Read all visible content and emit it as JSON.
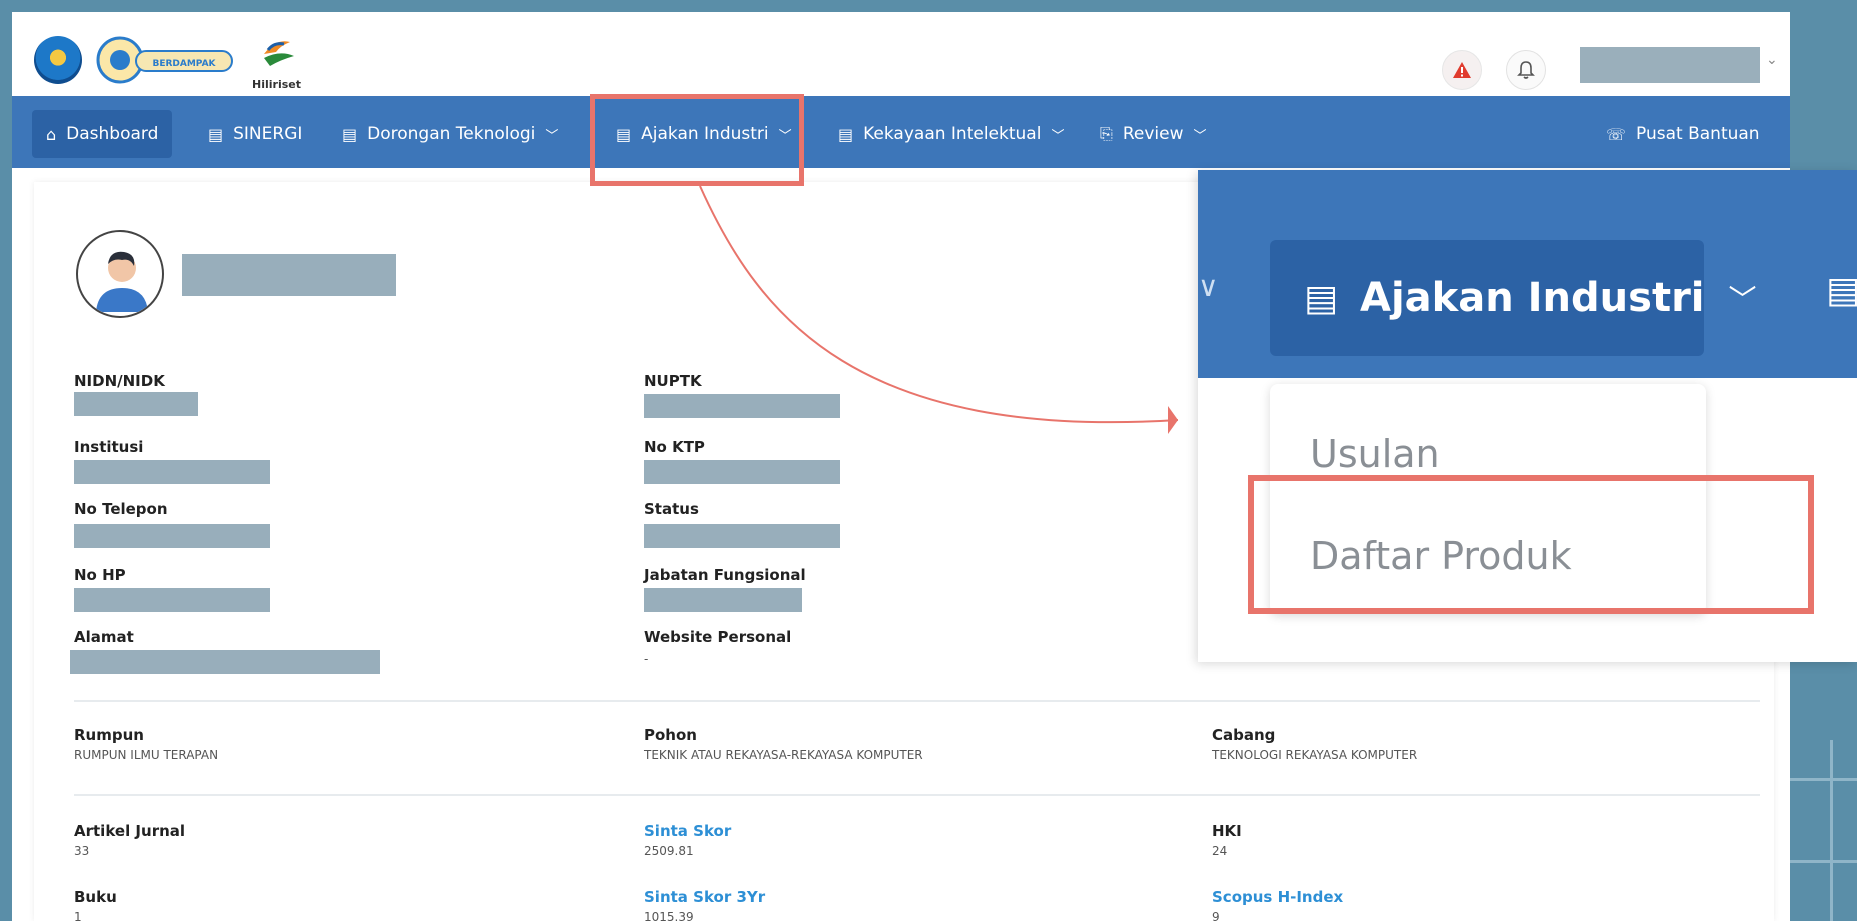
{
  "header": {
    "brand_text": "Hiliriset",
    "logo_berdampak_text": "BERDAMPAK",
    "logos": [
      "kemdikbud-logo",
      "berdampak-logo",
      "hiliriset-logo"
    ],
    "icons": [
      "alert-icon",
      "bell-icon",
      "chevron-down-icon"
    ]
  },
  "nav": {
    "items": [
      {
        "label": "Dashboard",
        "icon": "home-icon"
      },
      {
        "label": "SINERGI",
        "icon": "document-icon"
      },
      {
        "label": "Dorongan Teknologi",
        "icon": "document-icon",
        "dropdown": true
      },
      {
        "label": "Ajakan Industri",
        "icon": "document-icon",
        "dropdown": true
      },
      {
        "label": "Kekayaan Intelektual",
        "icon": "document-icon",
        "dropdown": true
      },
      {
        "label": "Review",
        "icon": "review-icon",
        "dropdown": true
      }
    ],
    "help_label": "Pusat Bantuan"
  },
  "profile": {
    "fields_left": [
      {
        "label": "NIDN/NIDK"
      },
      {
        "label": "Institusi"
      },
      {
        "label": "No Telepon"
      },
      {
        "label": "No HP"
      },
      {
        "label": "Alamat"
      }
    ],
    "fields_mid": [
      {
        "label": "NUPTK"
      },
      {
        "label": "No KTP"
      },
      {
        "label": "Status"
      },
      {
        "label": "Jabatan Fungsional"
      },
      {
        "label": "Website Personal",
        "value": "-"
      }
    ]
  },
  "classification": {
    "rumpun_label": "Rumpun",
    "rumpun_value": "RUMPUN ILMU TERAPAN",
    "pohon_label": "Pohon",
    "pohon_value": "TEKNIK ATAU REKAYASA-REKAYASA KOMPUTER",
    "cabang_label": "Cabang",
    "cabang_value": "TEKNOLOGI REKAYASA KOMPUTER"
  },
  "stats": {
    "artikel_label": "Artikel Jurnal",
    "artikel_value": "33",
    "buku_label": "Buku",
    "buku_value": "1",
    "sinta_label": "Sinta Skor",
    "sinta_value": "2509.81",
    "sinta3_label": "Sinta Skor 3Yr",
    "sinta3_value": "1015.39",
    "hki_label": "HKI",
    "hki_value": "24",
    "scopus_label": "Scopus H-Index",
    "scopus_value": "9"
  },
  "zoom": {
    "tab_label": "Ajakan Industri",
    "dropdown_items": [
      "Usulan",
      "Daftar Produk"
    ]
  },
  "colors": {
    "navbar": "#3d76b9",
    "navbar_active": "#2c62a5",
    "highlight": "#e8746b",
    "link": "#2d8fd5",
    "redacted": "#98aebb"
  }
}
